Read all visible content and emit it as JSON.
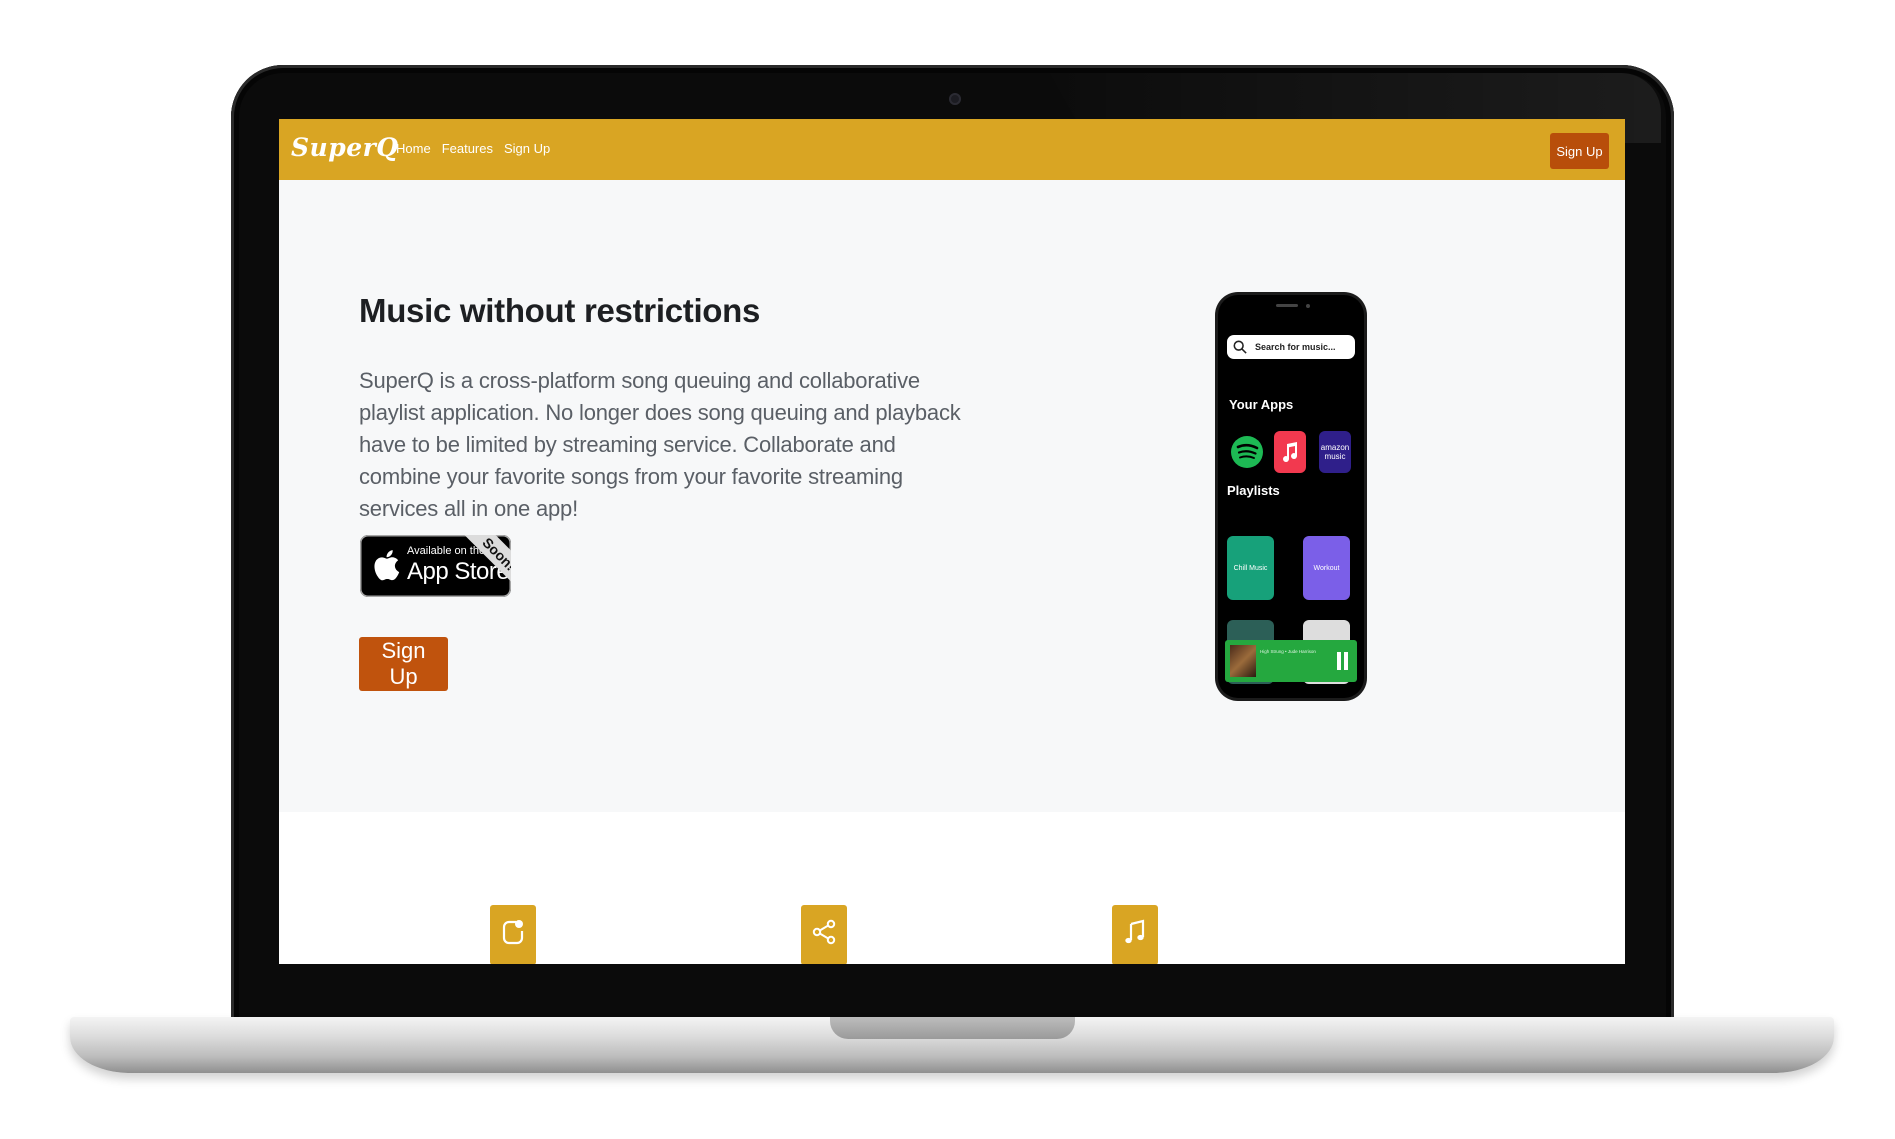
{
  "nav": {
    "brand": "SuperQ",
    "links": [
      "Home",
      "Features",
      "Sign Up"
    ],
    "signup_button": "Sign Up"
  },
  "hero": {
    "title": "Music without restrictions",
    "description": "SuperQ is a cross-platform song queuing and collaborative playlist application. No longer does song queuing and playback have to be limited by streaming service. Collaborate and combine your favorite songs from your favorite streaming services all in one app!",
    "appstore_small": "Available on the",
    "appstore_big": "App Store",
    "appstore_ribbon": "Soon!",
    "signup_button": "Sign Up"
  },
  "phone": {
    "search_placeholder": "Search for music...",
    "your_apps_label": "Your Apps",
    "apps": [
      "spotify-icon",
      "apple-music-icon",
      "amazon-music-icon"
    ],
    "amazon_label_top": "amazon",
    "amazon_label_bottom": "music",
    "playlists_label": "Playlists",
    "playlists": [
      "Chill Music",
      "Workout"
    ],
    "now_playing": "High Strung • Jude Harrison"
  },
  "features": {
    "icons": [
      "shape-icon",
      "share-icon",
      "music-note-icon"
    ]
  },
  "colors": {
    "navbar": "#d9a523",
    "signup": "#c0530d",
    "spotify": "#1db954",
    "apple_music": "#f2394f",
    "amazon_music": "#2f1f8a"
  }
}
